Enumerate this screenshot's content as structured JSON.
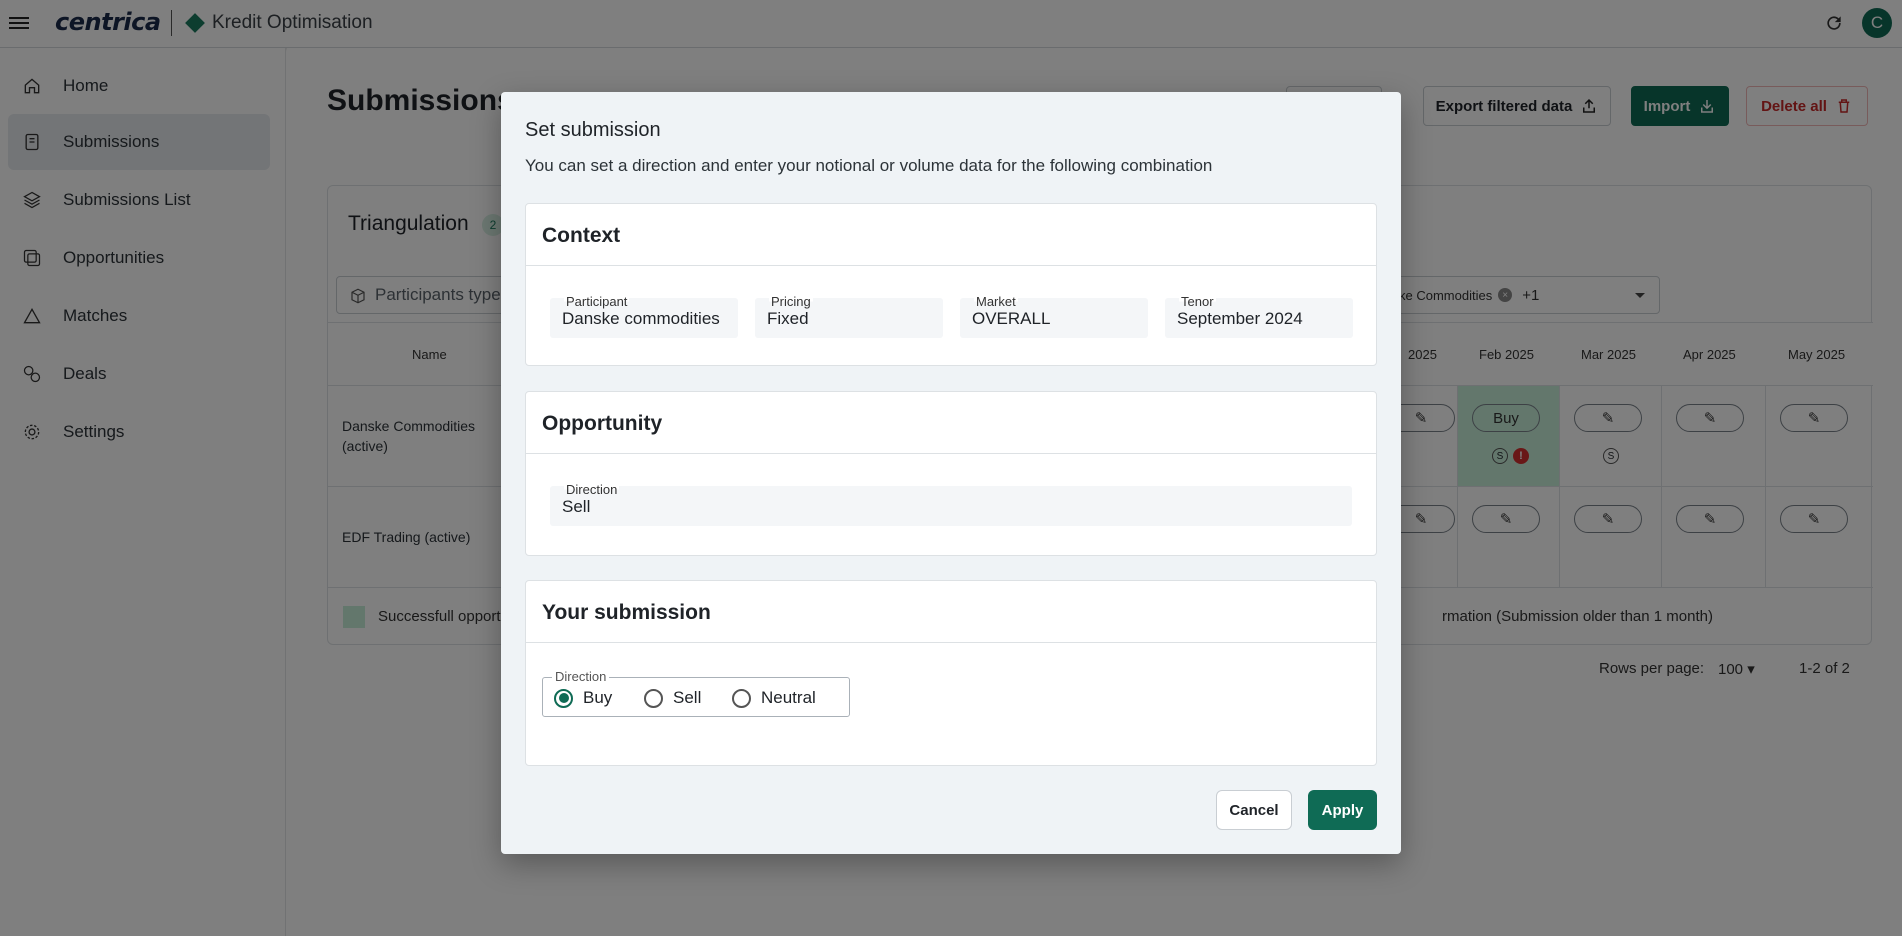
{
  "app": {
    "logo": "centrica",
    "name": "Kredit Optimisation",
    "avatar_initial": "C"
  },
  "sidebar": {
    "items": [
      {
        "label": "Home",
        "icon": "home-icon"
      },
      {
        "label": "Submissions",
        "icon": "document-icon",
        "active": true
      },
      {
        "label": "Submissions List",
        "icon": "layers-icon"
      },
      {
        "label": "Opportunities",
        "icon": "opportunities-icon"
      },
      {
        "label": "Matches",
        "icon": "triangle-icon"
      },
      {
        "label": "Deals",
        "icon": "deals-icon"
      },
      {
        "label": "Settings",
        "icon": "gear-icon"
      }
    ]
  },
  "page": {
    "title": "Submissions",
    "toolbar": {
      "export_label": "Export filtered data",
      "import_label": "Import",
      "delete_label": "Delete all"
    },
    "card": {
      "title": "Triangulation",
      "count": "2",
      "filter_placeholder": "Participants type",
      "chip_text": "ke Commodities",
      "chip_more": "+1",
      "columns": [
        "Name",
        "2025",
        "Feb 2025",
        "Mar 2025",
        "Apr 2025",
        "May 2025"
      ],
      "rows": [
        {
          "name": "Danske Commodities (active)",
          "feb_label": "Buy"
        },
        {
          "name": "EDF Trading (active)"
        }
      ],
      "legend_left": "Successfull opport",
      "legend_right": "rmation (Submission older than 1 month)"
    },
    "pagination": {
      "rows_label": "Rows per page:",
      "rows_value": "100",
      "range": "1-2 of 2"
    }
  },
  "modal": {
    "title": "Set submission",
    "subtitle": "You can set a direction and enter your notional or volume data for the following combination",
    "context": {
      "heading": "Context",
      "fields": [
        {
          "label": "Participant",
          "value": "Danske commodities"
        },
        {
          "label": "Pricing",
          "value": "Fixed"
        },
        {
          "label": "Market",
          "value": "OVERALL"
        },
        {
          "label": "Tenor",
          "value": "September 2024"
        }
      ]
    },
    "opportunity": {
      "heading": "Opportunity",
      "direction_label": "Direction",
      "direction_value": "Sell"
    },
    "submission": {
      "heading": "Your submission",
      "direction_label": "Direction",
      "options": [
        "Buy",
        "Sell",
        "Neutral"
      ],
      "selected": "Buy"
    },
    "cancel_label": "Cancel",
    "apply_label": "Apply"
  },
  "colors": {
    "primary": "#0f6b55",
    "success_cell": "#c6eed9",
    "danger": "#d32f2f"
  }
}
